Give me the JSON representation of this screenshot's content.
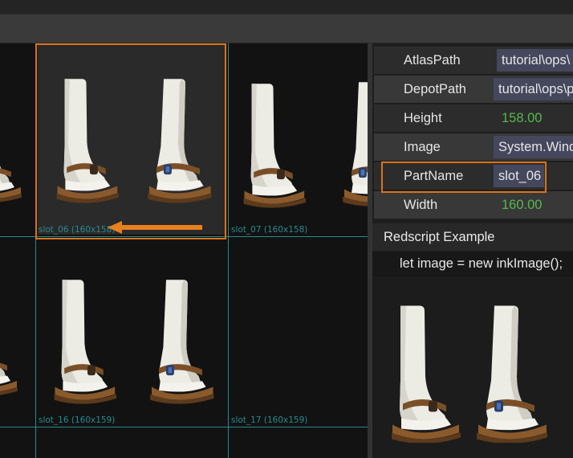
{
  "atlas": {
    "slots": [
      {
        "label": "slot_06 (160x158)"
      },
      {
        "label": "slot_07 (160x158)"
      },
      {
        "label": "slot_16 (160x159)"
      },
      {
        "label": "slot_17 (160x159)"
      }
    ],
    "selection_color": "#d9741a",
    "grid_color": "#2a8a8e"
  },
  "properties": {
    "rows": [
      {
        "key": "AtlasPath",
        "value": "tutorial\\ops\\"
      },
      {
        "key": "DepotPath",
        "value": "tutorial\\ops\\p"
      },
      {
        "key": "Height",
        "value": "158.00"
      },
      {
        "key": "Image",
        "value": "System.Windo"
      },
      {
        "key": "PartName",
        "value": "slot_06"
      },
      {
        "key": "Width",
        "value": "160.00"
      }
    ]
  },
  "redscript": {
    "title": "Redscript Example",
    "code": "let image = new inkImage();"
  },
  "icons": {
    "arrow": "left-arrow-icon",
    "thumbnail": "white-sock-sandals-icon"
  }
}
